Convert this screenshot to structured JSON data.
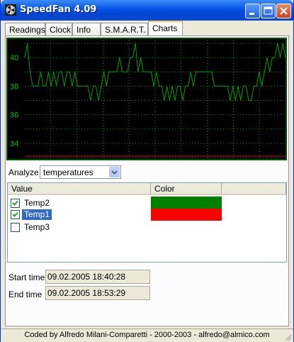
{
  "window": {
    "title": "SpeedFan 4.09",
    "icon": "fan-icon"
  },
  "tabs": [
    {
      "label": "Readings",
      "active": false
    },
    {
      "label": "Clock",
      "active": false
    },
    {
      "label": "Info",
      "active": false
    },
    {
      "label": "S.M.A.R.T.",
      "active": false
    },
    {
      "label": "Charts",
      "active": true
    }
  ],
  "chart_data": {
    "type": "line",
    "title": "",
    "xlabel": "",
    "ylabel": "",
    "ylim": [
      33,
      41.2
    ],
    "yticks": [
      34,
      36,
      38,
      40
    ],
    "grid": true,
    "background": "#000000",
    "series": [
      {
        "name": "Temp2",
        "color": "#00A000",
        "values": [
          40,
          41,
          39,
          38,
          38,
          38,
          39,
          38,
          38,
          39,
          38,
          39,
          38,
          39,
          39,
          38,
          39,
          39,
          38,
          39,
          38,
          38,
          38,
          38,
          38,
          37,
          38,
          38,
          37,
          38,
          39,
          38,
          39,
          39,
          39,
          39,
          40,
          39,
          39,
          39,
          40,
          40,
          41,
          39,
          40,
          39,
          39,
          39,
          39,
          38,
          39,
          38,
          38,
          37,
          38,
          37,
          38,
          37,
          38,
          38,
          37,
          38,
          38,
          39,
          38,
          39,
          39,
          39,
          39,
          39,
          39,
          39,
          38,
          38,
          38,
          38,
          38,
          38,
          37,
          38,
          37,
          38,
          37,
          38,
          38,
          37,
          37,
          38,
          38,
          39,
          38,
          39,
          40,
          39,
          40,
          40,
          41,
          40,
          41,
          40
        ]
      },
      {
        "name": "Temp1",
        "color": "#E00000",
        "values": [
          33.1,
          33.1,
          33.1,
          33.1,
          33.1,
          33.1,
          33.1,
          33.1,
          33.1,
          33.1,
          33.1,
          33.1,
          33.1,
          33.1,
          33.1,
          33.1,
          33.1,
          33.1,
          33.1,
          33.1
        ]
      }
    ]
  },
  "analyze": {
    "label": "Analyze",
    "value": "temperatures"
  },
  "list": {
    "headers": [
      "Value",
      "Color"
    ],
    "rows": [
      {
        "label": "Temp2",
        "checked": true,
        "selected": false,
        "color": "#008000"
      },
      {
        "label": "Temp1",
        "checked": true,
        "selected": true,
        "color": "#FF0000"
      },
      {
        "label": "Temp3",
        "checked": false,
        "selected": false,
        "color": ""
      }
    ]
  },
  "times": {
    "start_label": "Start time",
    "start_value": "09.02.2005 18:40:28",
    "end_label": "End time",
    "end_value": "09.02.2005 18:53:29"
  },
  "status": {
    "text": "Coded by Alfredo Milani-Comparetti - 2000-2003 - alfredo@almico.com"
  }
}
